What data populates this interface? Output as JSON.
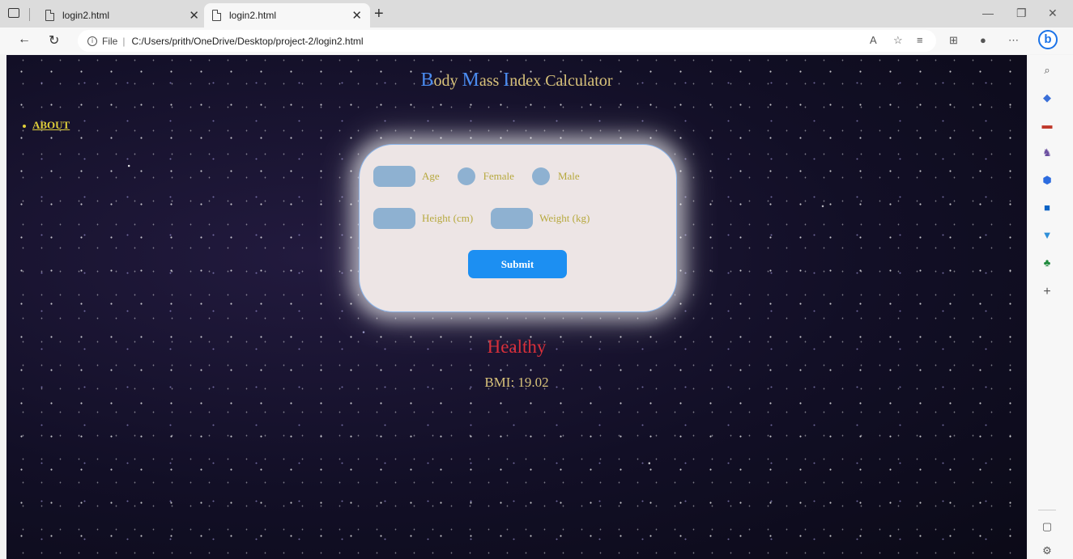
{
  "browser": {
    "tabs": [
      {
        "title": "login2.html",
        "active": false
      },
      {
        "title": "login2.html",
        "active": true
      }
    ],
    "address": {
      "info_label": "i",
      "file_label": "File",
      "url": "C:/Users/prith/OneDrive/Desktop/project-2/login2.html"
    },
    "accent_color": "#1b73e8"
  },
  "page": {
    "title_parts": [
      {
        "cap": "B",
        "rest": "ody "
      },
      {
        "cap": "M",
        "rest": "ass "
      },
      {
        "cap": "I",
        "rest": "ndex "
      },
      {
        "cap": "",
        "rest": "Calculator"
      }
    ],
    "nav": {
      "about_label": "ABOUT"
    },
    "form": {
      "age_label": "Age",
      "female_label": "Female",
      "male_label": "Male",
      "height_label": "Height (cm)",
      "weight_label": "Weight (kg)",
      "submit_label": "Submit"
    },
    "result": {
      "status": "Healthy",
      "bmi_text": "BMI: 19.02"
    },
    "colors": {
      "title_cap": "#4b8cf0",
      "title_text": "#d8c27a",
      "status": "#d8303a",
      "submit": "#1c8ff2"
    }
  }
}
